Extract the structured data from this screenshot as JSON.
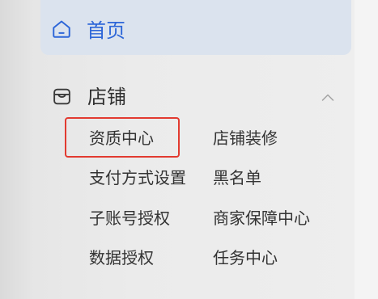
{
  "sidebar": {
    "home": {
      "label": "首页",
      "icon": "home-icon",
      "active": true
    },
    "store": {
      "label": "店铺",
      "icon": "store-icon",
      "toggle_icon": "chevron-up-icon",
      "expanded": true,
      "items": [
        {
          "label": "资质中心",
          "highlighted": true
        },
        {
          "label": "店铺装修"
        },
        {
          "label": "支付方式设置"
        },
        {
          "label": "黑名单"
        },
        {
          "label": "子账号授权"
        },
        {
          "label": "商家保障中心"
        },
        {
          "label": "数据授权"
        },
        {
          "label": "任务中心"
        }
      ]
    }
  },
  "colors": {
    "accent": "#2d66d8",
    "highlight_border": "#e23a30",
    "text": "#333333",
    "active_bg": "#dbe3ee",
    "muted": "#a3a3a3"
  }
}
